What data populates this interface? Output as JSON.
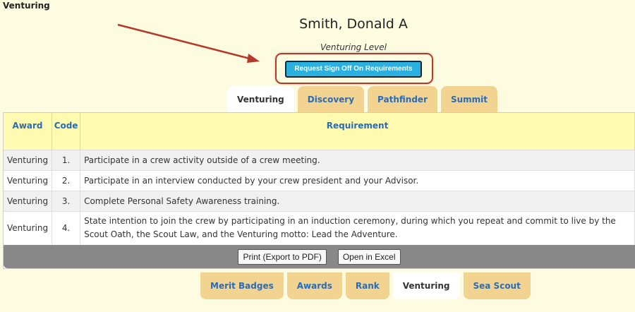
{
  "page": {
    "section_label": "Venturing"
  },
  "person": {
    "name": "Smith, Donald A",
    "level": "Venturing Level"
  },
  "actions": {
    "request_signoff": "Request Sign Off On Requirements"
  },
  "top_tabs": [
    {
      "label": "Venturing",
      "active": true
    },
    {
      "label": "Discovery",
      "active": false
    },
    {
      "label": "Pathfinder",
      "active": false
    },
    {
      "label": "Summit",
      "active": false
    }
  ],
  "table": {
    "headers": [
      "Award",
      "Code",
      "Requirement"
    ],
    "rows": [
      {
        "award": "Venturing",
        "code": "1.",
        "requirement": "Participate in a crew activity outside of a crew meeting."
      },
      {
        "award": "Venturing",
        "code": "2.",
        "requirement": "Participate in an interview conducted by your crew president and your Advisor."
      },
      {
        "award": "Venturing",
        "code": "3.",
        "requirement": "Complete Personal Safety Awareness training."
      },
      {
        "award": "Venturing",
        "code": "4.",
        "requirement": "State intention to join the crew by participating in an induction ceremony, during which you repeat and commit to live by the Scout Oath, the Scout Law, and the Venturing motto: Lead the Adventure."
      }
    ]
  },
  "footer": {
    "print_label": "Print (Export to PDF)",
    "excel_label": "Open in Excel"
  },
  "bottom_tabs": [
    {
      "label": "Merit Badges",
      "active": false
    },
    {
      "label": "Awards",
      "active": false
    },
    {
      "label": "Rank",
      "active": false
    },
    {
      "label": "Venturing",
      "active": true
    },
    {
      "label": "Sea Scout",
      "active": false
    }
  ],
  "colors": {
    "background": "#fdfbe0",
    "tab": "#f2d490",
    "link": "#2a6bb8",
    "header_row": "#fffbb0",
    "button": "#2bb0e0",
    "annotation": "#b33a2a"
  },
  "icons": {
    "annotation": "arrow-pointer-icon"
  }
}
